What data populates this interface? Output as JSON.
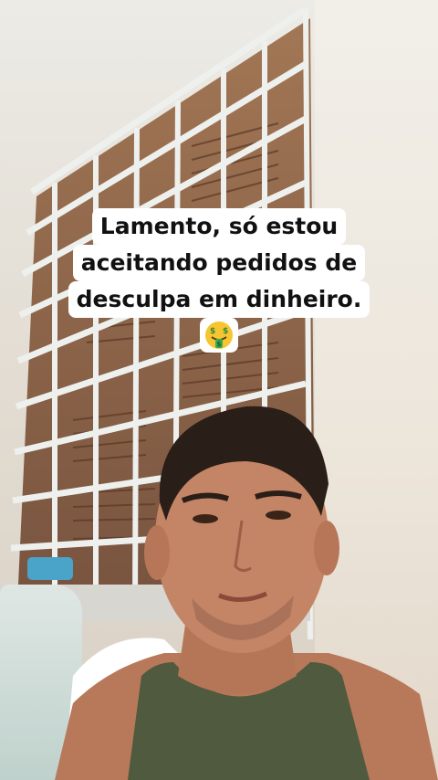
{
  "caption": {
    "lines": [
      "Lamento, só estou",
      "aceitando pedidos de",
      "desculpa em dinheiro."
    ],
    "emoji": "money-mouth-face-icon"
  },
  "colors": {
    "caption_bg": "#ffffff",
    "caption_text": "#111111",
    "window_grille": "#e8ebe9",
    "shutter": "#8a5a3a",
    "shirt": "#4f5a3e"
  }
}
